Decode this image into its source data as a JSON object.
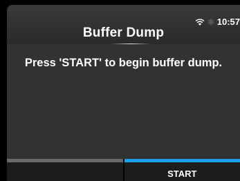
{
  "header": {
    "title": "Buffer Dump",
    "time": "10:57"
  },
  "status": {
    "wifi_icon": "wifi-icon",
    "bluetooth_icon": "bluetooth-icon"
  },
  "message": "Press 'START' to begin buffer dump.",
  "softkeys": {
    "left_label": "",
    "right_label": "START"
  },
  "colors": {
    "accent": "#1aa0e6",
    "panel": "#323232",
    "header": "#2f2f2f"
  }
}
